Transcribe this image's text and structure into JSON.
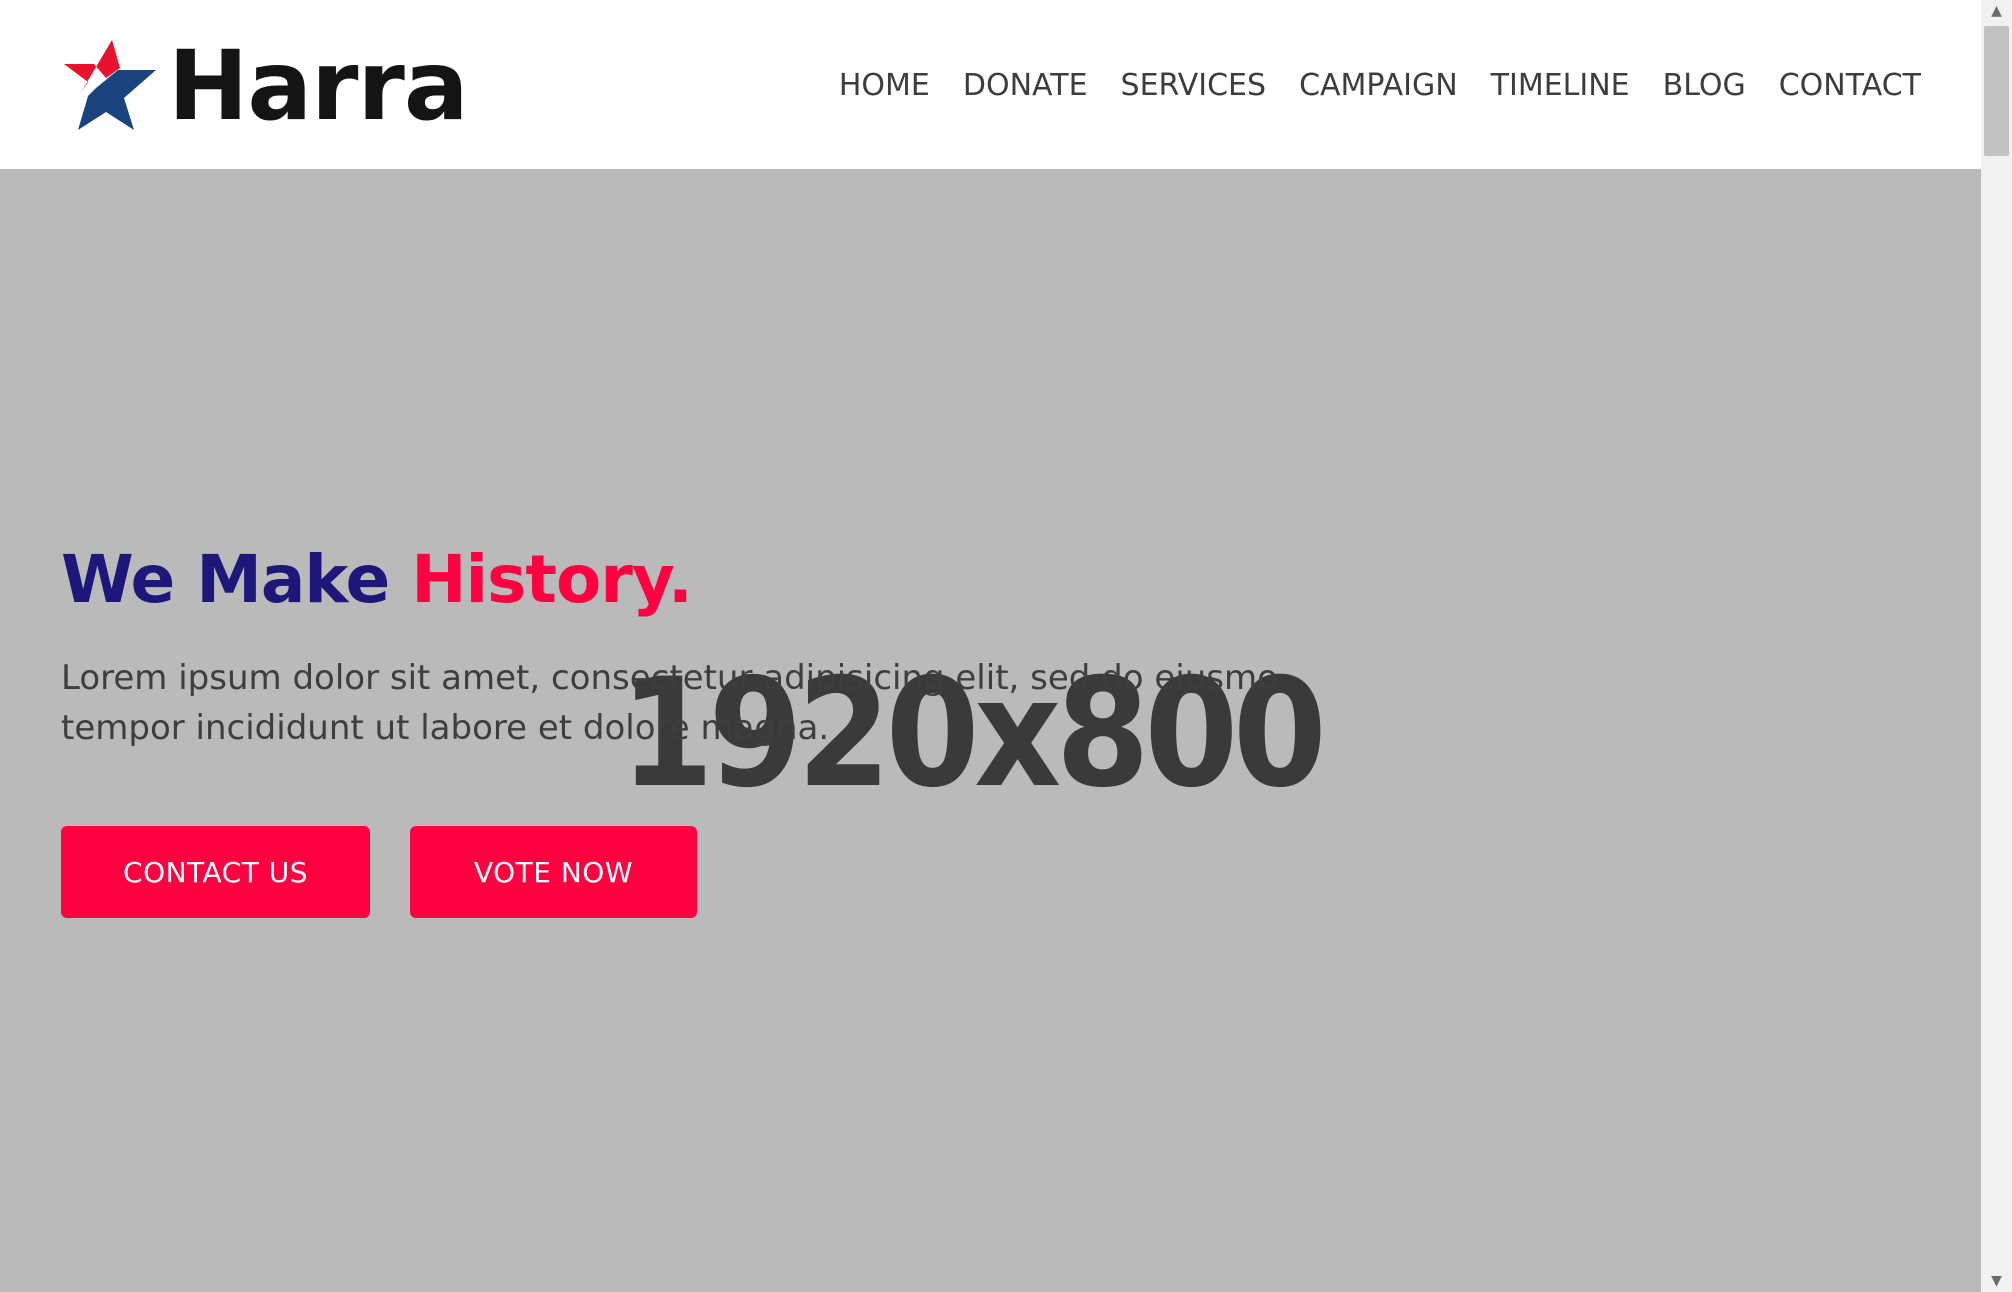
{
  "brand": {
    "name": "Harra",
    "colors": {
      "accent": "#ff0040",
      "title_dark": "#1c1778",
      "star_red": "#e8122f",
      "star_blue": "#1a4480",
      "hero_bg": "#bababa"
    }
  },
  "nav": {
    "items": [
      {
        "label": "HOME",
        "active": true
      },
      {
        "label": "DONATE",
        "active": false
      },
      {
        "label": "SERVICES",
        "active": false
      },
      {
        "label": "CAMPAIGN",
        "active": false
      },
      {
        "label": "TIMELINE",
        "active": false
      },
      {
        "label": "BLOG",
        "active": false
      },
      {
        "label": "CONTACT",
        "active": false
      }
    ]
  },
  "hero": {
    "placeholder_label": "1920x800",
    "title_main": "We Make ",
    "title_accent": "History.",
    "text": "Lorem ipsum dolor sit amet, consectetur adipisicing elit, sed do eiusmo tempor incididunt ut labore et dolore magna.",
    "buttons": {
      "contact": "CONTACT US",
      "vote": "VOTE NOW"
    }
  },
  "scrollbar": {
    "up_icon": "▲",
    "down_icon": "▼"
  }
}
